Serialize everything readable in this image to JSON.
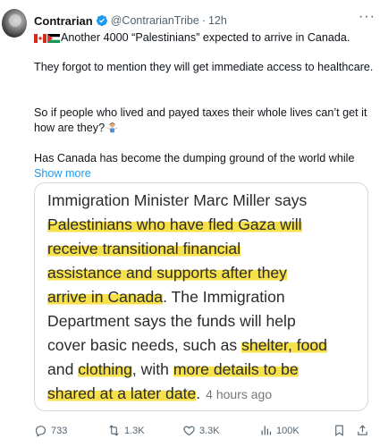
{
  "author": {
    "name": "Contrarian",
    "handle": "@ContrarianTribe",
    "separator": "·",
    "time": "12h",
    "more_icon": "more-horizontal-icon",
    "more_label": "···"
  },
  "tweet": {
    "flags": [
      "canada-flag",
      "palestine-flag"
    ],
    "line1": "Another 4000 “Palestinians” expected to arrive in Canada.",
    "para2": "They forgot to mention they will get immediate access to healthcare.",
    "para3": "So if people who lived and payed taxes their whole lives can’t get it how are they?",
    "para3_emoji": "person-shrugging-emoji",
    "para4": "Has Canada has become the dumping ground of the world while",
    "show_more": "Show more"
  },
  "card": {
    "lines": [
      [
        {
          "t": "Immigration Minister Marc Miller says",
          "hl": false
        }
      ],
      [
        {
          "t": "Palestinians who have fled Gaza will",
          "hl": true
        }
      ],
      [
        {
          "t": "receive transitional financial",
          "hl": true
        }
      ],
      [
        {
          "t": "assistance and supports after they",
          "hl": true
        }
      ],
      [
        {
          "t": "arrive in Canada",
          "hl": true
        },
        {
          "t": ". The Immigration",
          "hl": false
        }
      ],
      [
        {
          "t": "Department says the funds will help",
          "hl": false
        }
      ],
      [
        {
          "t": "cover basic needs, such as ",
          "hl": false
        },
        {
          "t": "shelter, food",
          "hl": true
        }
      ],
      [
        {
          "t": "and ",
          "hl": false
        },
        {
          "t": "clothing",
          "hl": true
        },
        {
          "t": ", with ",
          "hl": false
        },
        {
          "t": "more details to be",
          "hl": true
        }
      ],
      [
        {
          "t": "shared at a later date",
          "hl": true
        },
        {
          "t": ".",
          "hl": false
        }
      ]
    ],
    "timestamp": "4 hours ago",
    "highlight_color": "#f7e14a"
  },
  "actions": {
    "reply": {
      "icon": "reply-icon",
      "count": "733"
    },
    "retweet": {
      "icon": "retweet-icon",
      "count": "1.3K"
    },
    "like": {
      "icon": "heart-icon",
      "count": "3.3K"
    },
    "views": {
      "icon": "views-chart-icon",
      "count": "100K"
    },
    "bookmark": {
      "icon": "bookmark-icon"
    },
    "share": {
      "icon": "share-icon"
    }
  },
  "colors": {
    "text": "#0f1419",
    "muted": "#536471",
    "link": "#1d9bf0",
    "verified": "#1d9bf0"
  }
}
